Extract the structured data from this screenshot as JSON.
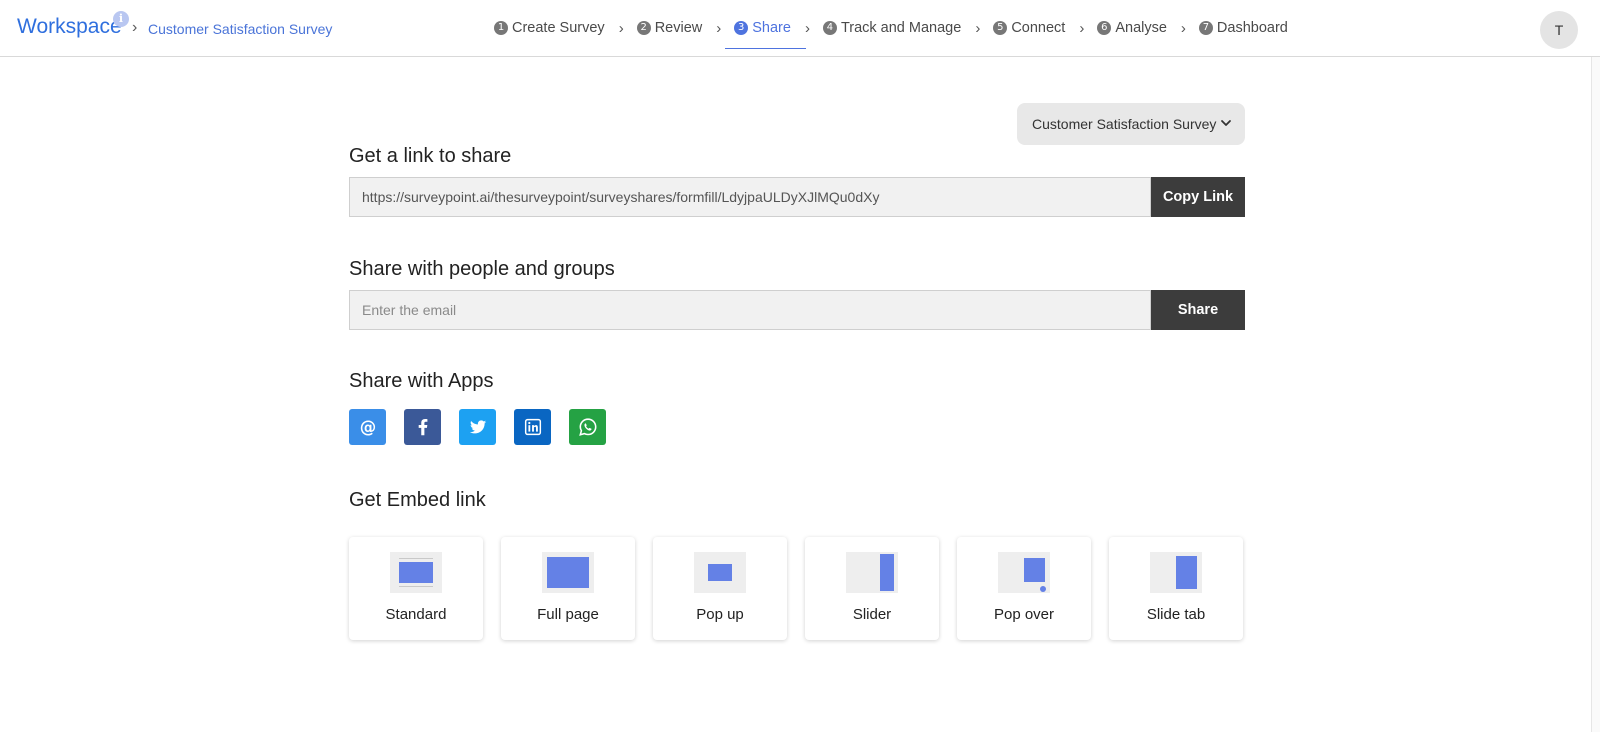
{
  "header": {
    "brand": "Workspace",
    "info_icon": "i",
    "breadcrumb_sep": "›",
    "survey_name": "Customer Satisfaction Survey",
    "steps": [
      {
        "num": "1",
        "label": "Create Survey"
      },
      {
        "num": "2",
        "label": "Review"
      },
      {
        "num": "3",
        "label": "Share"
      },
      {
        "num": "4",
        "label": "Track and Manage"
      },
      {
        "num": "5",
        "label": "Connect"
      },
      {
        "num": "6",
        "label": "Analyse"
      },
      {
        "num": "7",
        "label": "Dashboard"
      }
    ],
    "step_sep": "›",
    "active_step": "Share",
    "avatar_initial": "T"
  },
  "survey_selector": {
    "selected": "Customer Satisfaction Survey"
  },
  "link_section": {
    "title": "Get a link to share",
    "url": "https://surveypoint.ai/thesurveypoint/surveyshares/formfill/LdyjpaULDyXJlMQu0dXy",
    "button": "Copy Link"
  },
  "people_section": {
    "title": "Share with people and groups",
    "placeholder": "Enter the email",
    "button": "Share"
  },
  "apps_section": {
    "title": "Share with Apps",
    "apps": [
      {
        "icon": "email-icon",
        "color": "#3a8ee8"
      },
      {
        "icon": "facebook-icon",
        "color": "#3b5998"
      },
      {
        "icon": "twitter-icon",
        "color": "#1da1f2"
      },
      {
        "icon": "linkedin-icon",
        "color": "#0a66c2"
      },
      {
        "icon": "whatsapp-icon",
        "color": "#25a244"
      }
    ]
  },
  "embed_section": {
    "title": "Get Embed link",
    "options": [
      {
        "label": "Standard"
      },
      {
        "label": "Full page"
      },
      {
        "label": "Pop up"
      },
      {
        "label": "Slider"
      },
      {
        "label": "Pop over"
      },
      {
        "label": "Slide tab"
      }
    ]
  },
  "colors": {
    "accent": "#4e73df",
    "brand": "#2f6fde",
    "dark_button": "#3c3c3c",
    "embed_block": "#6481e6"
  }
}
